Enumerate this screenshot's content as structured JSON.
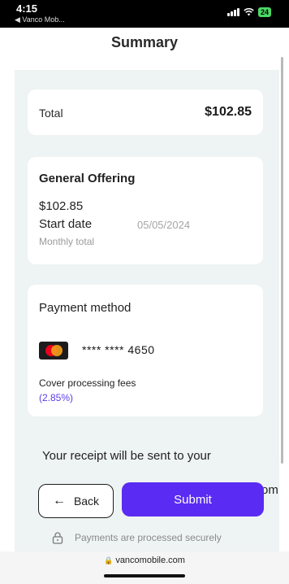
{
  "status_bar": {
    "time": "4:15",
    "back_label": "◀ Vanco Mob...",
    "battery": "24"
  },
  "header": {
    "title": "Summary"
  },
  "total": {
    "label": "Total",
    "value": "$102.85"
  },
  "offering": {
    "title": "General Offering",
    "amount": "$102.85",
    "start_label": "Start date",
    "start_value": "05/05/2024",
    "frequency": "Monthly total"
  },
  "payment": {
    "title": "Payment method",
    "card_number": "**** **** 4650",
    "fees_label": "Cover processing fees",
    "fees_rate": "(2.85%)"
  },
  "receipt": {
    "text": "Your receipt will be sent to your",
    "overflow": "om"
  },
  "actions": {
    "back_label": "Back",
    "submit_label": "Submit"
  },
  "secure_note": "Payments are processed securely",
  "url": "vancomobile.com",
  "colors": {
    "accent": "#5a2bf2",
    "background": "#eef3f3",
    "link": "#5b3be8"
  }
}
